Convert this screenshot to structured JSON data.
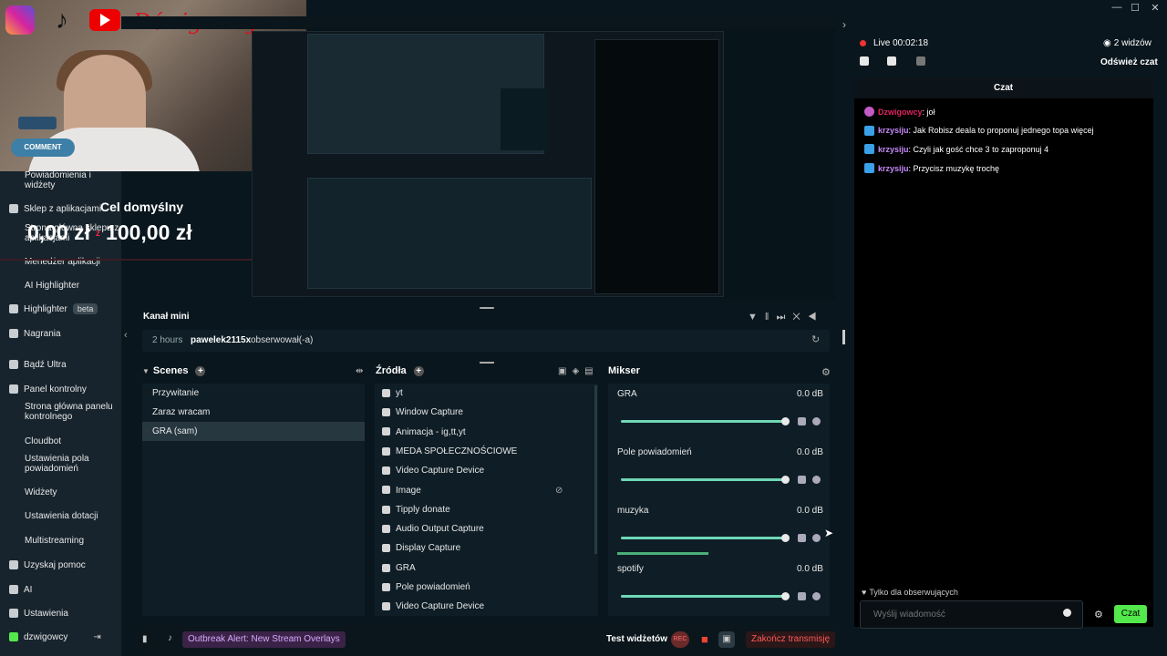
{
  "window": {
    "minimize": "—",
    "maximize": "☐",
    "close": "✕"
  },
  "overlay": {
    "brand": "Dźwigowcy",
    "comment_label": "COMMENT",
    "goal_title": "Cel domyślny",
    "goal_current": "0,00 zł",
    "goal_sep": "z",
    "goal_target": "100,00 zł"
  },
  "sidebar": {
    "items": [
      {
        "label": "Powiadomienia i widżety",
        "sub": true
      },
      {
        "label": "Sklep z aplikacjami",
        "sub": false
      },
      {
        "label": "Strona główna sklepu z aplikacjami",
        "sub": true
      },
      {
        "label": "Menedżer aplikacji",
        "sub": true
      },
      {
        "label": "AI Highlighter",
        "sub": true
      },
      {
        "label": "Highlighter",
        "sub": false,
        "badge": "beta"
      },
      {
        "label": "Nagrania",
        "sub": false
      },
      {
        "label": "Bądź Ultra",
        "sub": false
      },
      {
        "label": "Panel kontrolny",
        "sub": false
      },
      {
        "label": "Strona główna panelu kontrolnego",
        "sub": true
      },
      {
        "label": "Cloudbot",
        "sub": true
      },
      {
        "label": "Ustawienia pola powiadomień",
        "sub": true
      },
      {
        "label": "Widżety",
        "sub": true
      },
      {
        "label": "Ustawienia dotacji",
        "sub": true
      },
      {
        "label": "Multistreaming",
        "sub": true
      },
      {
        "label": "Uzyskaj pomoc",
        "sub": false
      },
      {
        "label": "AI",
        "sub": false
      },
      {
        "label": "Ustawienia",
        "sub": false
      }
    ],
    "user": "dzwigowcy"
  },
  "kanal_mini": {
    "title": "Kanał mini",
    "activity_time": "2 hours",
    "activity_user": "pawelek2115x",
    "activity_text": "obserwował(-a)"
  },
  "scenes": {
    "title": "Scenes",
    "items": [
      "Przywitanie",
      "Zaraz wracam",
      "GRA (sam)"
    ],
    "selected": "GRA (sam)"
  },
  "sources": {
    "title": "Źródła",
    "items": [
      "yt",
      "Window Capture",
      "Animacja - ig,tt,yt",
      "MEDA SPOŁECZNOŚCIOWE",
      "Video Capture Device",
      "Image",
      "Tipply donate",
      "Audio Output Capture",
      "Display Capture",
      "GRA",
      "Pole powiadomień",
      "Video Capture Device"
    ]
  },
  "mixer": {
    "title": "Mikser",
    "channels": [
      {
        "name": "GRA",
        "db": "0.0 dB",
        "level": 1.0
      },
      {
        "name": "Pole powiadomień",
        "db": "0.0 dB",
        "level": 1.0
      },
      {
        "name": "muzyka",
        "db": "0.0 dB",
        "level": 1.0,
        "meter": 0.45
      },
      {
        "name": "spotify",
        "db": "0.0 dB",
        "level": 1.0
      }
    ]
  },
  "bottombar": {
    "alert": "Outbreak Alert: New Stream Overlays",
    "test_widgets": "Test widżetów",
    "rec": "REC",
    "end_stream": "Zakończ transmisję"
  },
  "chat": {
    "live": "Live 00:02:18",
    "viewers": "2 widzów",
    "refresh": "Odśwież czat",
    "title": "Czat",
    "messages": [
      {
        "user": "Dzwigowcy",
        "text": ": joł",
        "user_color": "#e0245e",
        "mic": true
      },
      {
        "user": "krzysiju",
        "text": ": Jak Robisz deala to proponuj jednego topa więcej",
        "user_color": "#c58af9"
      },
      {
        "user": "krzysiju",
        "text": ": Czyli jak gość chce 3 to zaproponuj 4",
        "user_color": "#c58af9"
      },
      {
        "user": "krzysiju",
        "text": ": Przycisz muzykę trochę",
        "user_color": "#c58af9"
      }
    ],
    "followers_only": "Tylko dla obserwujących",
    "input_placeholder": "Wyślij wiadomość",
    "send": "Czat"
  },
  "colors": {
    "accent": "#53e84b",
    "mixer_track": "#6fd8b6",
    "end_stream": "#ff5a5a"
  }
}
